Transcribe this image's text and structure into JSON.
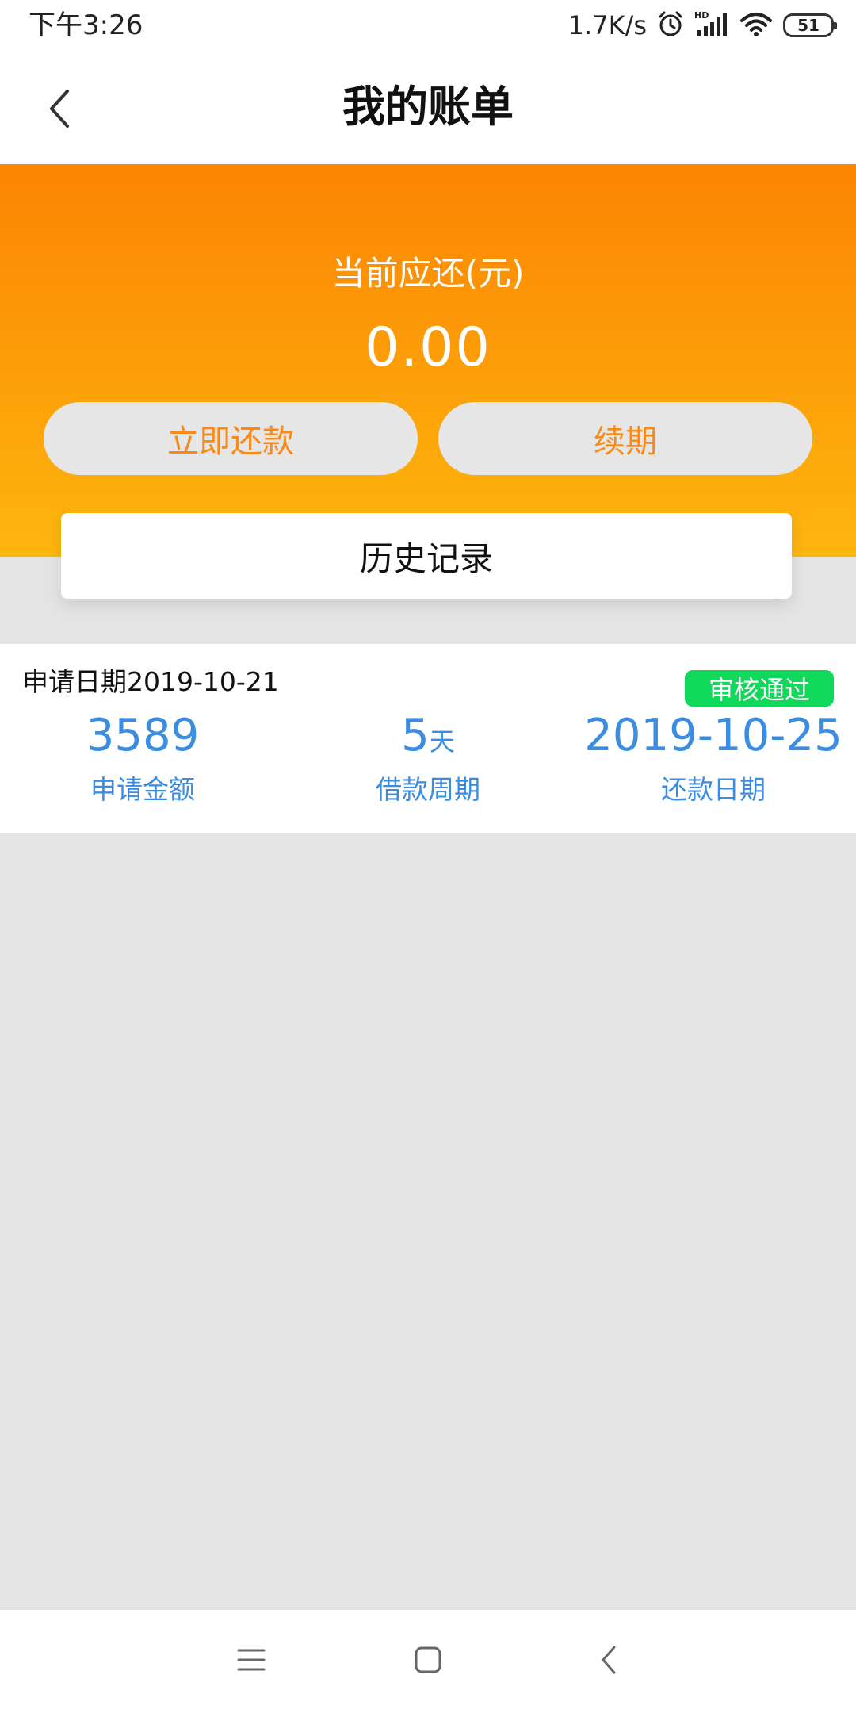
{
  "status_bar": {
    "time": "下午3:26",
    "net_speed": "1.7K/s",
    "battery": "51",
    "icons": [
      "alarm-icon",
      "hd-signal-icon",
      "wifi-icon",
      "battery-icon"
    ]
  },
  "header": {
    "title": "我的账单",
    "back_icon": "chevron-left-icon"
  },
  "banner": {
    "due_label": "当前应还(元)",
    "due_amount": "0.00",
    "repay_button": "立即还款",
    "renew_button": "续期",
    "gradient_top": "#fc8402",
    "gradient_bottom": "#fdb60f"
  },
  "history": {
    "label": "历史记录"
  },
  "record": {
    "apply_date": "申请日期2019-10-21",
    "status": "审核通过",
    "status_color": "#10d85a",
    "amount_value": "3589",
    "amount_label": "申请金额",
    "period_value": "5",
    "period_unit": "天",
    "period_label": "借款周期",
    "repay_date_value": "2019-10-25",
    "repay_date_label": "还款日期",
    "accent_color": "#3a8de0"
  },
  "bottom_nav": {
    "icons": [
      "menu-icon",
      "home-square-icon",
      "back-triangle-icon"
    ]
  }
}
